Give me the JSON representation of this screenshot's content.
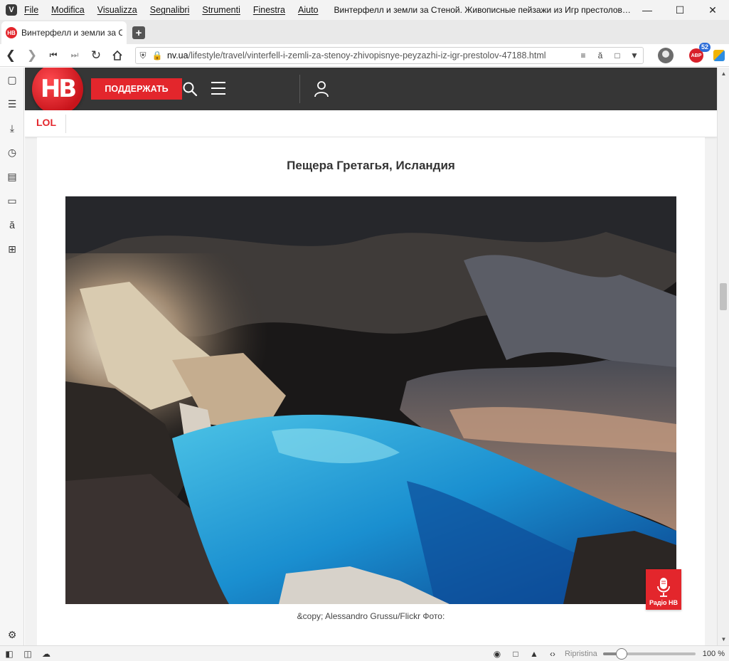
{
  "window": {
    "app_icon": "V",
    "menu": [
      "File",
      "Modifica",
      "Visualizza",
      "Segnalibri",
      "Strumenti",
      "Finestra",
      "Aiuto"
    ],
    "title": "Винтерфелл и земли за Стеной. Живописные пейзажи из Игр престолов ...",
    "controls": [
      "minimize-icon",
      "maximize-icon",
      "close-icon"
    ]
  },
  "tabs": [
    {
      "favicon": "НВ",
      "title": "Винтерфелл и земли за Ст",
      "active": true
    }
  ],
  "address_bar": {
    "host": "nv.ua",
    "path": "/lifestyle/travel/vinterfell-i-zemli-za-stenoy-zhivopisnye-peyzazhi-iz-igr-prestolov-47188.html",
    "abp_badge": "52",
    "abp_label": "ABP"
  },
  "site": {
    "logo": "НВ",
    "support_label": "ПОДДЕРЖАТЬ",
    "subnav_label": "LOL",
    "brand_color": "#e3262c",
    "header_color": "#363636"
  },
  "article": {
    "heading": "Пещера Гретагья, Исландия",
    "image_caption": "&copy; Alessandro Grussu/Flickr Фото:",
    "image_subject": "blue water pool inside dark rock cave"
  },
  "radio": {
    "label": "Радіо НВ"
  },
  "status_bar": {
    "reset_label": "Ripristina",
    "zoom_percent": "100 %",
    "zoom_level": 0.2
  }
}
